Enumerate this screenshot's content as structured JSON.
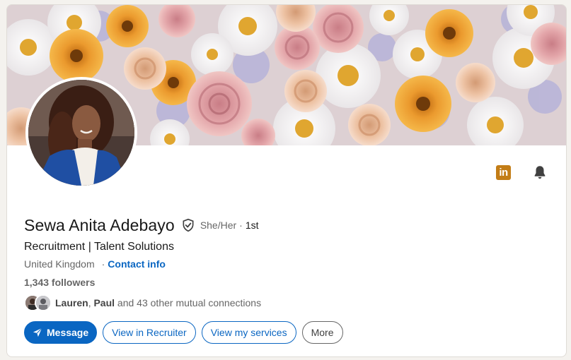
{
  "profile": {
    "name": "Sewa Anita Adebayo",
    "pronouns": "She/Her",
    "separator": "·",
    "degree": "1st",
    "headline": "Recruitment | Talent Solutions",
    "location": "United Kingdom",
    "contact_link": "Contact info",
    "followers": "1,343 followers"
  },
  "mutual": {
    "name1": "Lauren",
    "comma": ", ",
    "name2": "Paul",
    "rest": " and 43 other mutual connections"
  },
  "actions": {
    "message": "Message",
    "recruiter": "View in Recruiter",
    "services": "View my services",
    "more": "More"
  },
  "icons": {
    "linkedin": "in",
    "linkedin_icon": "linkedin-premium-icon",
    "bell_icon": "bell-icon",
    "verified_icon": "verified-shield-icon",
    "send_icon": "send-icon"
  },
  "colors": {
    "accent": "#0a66c2",
    "premium_gold": "#c37d16",
    "background": "#f4f2ee"
  }
}
